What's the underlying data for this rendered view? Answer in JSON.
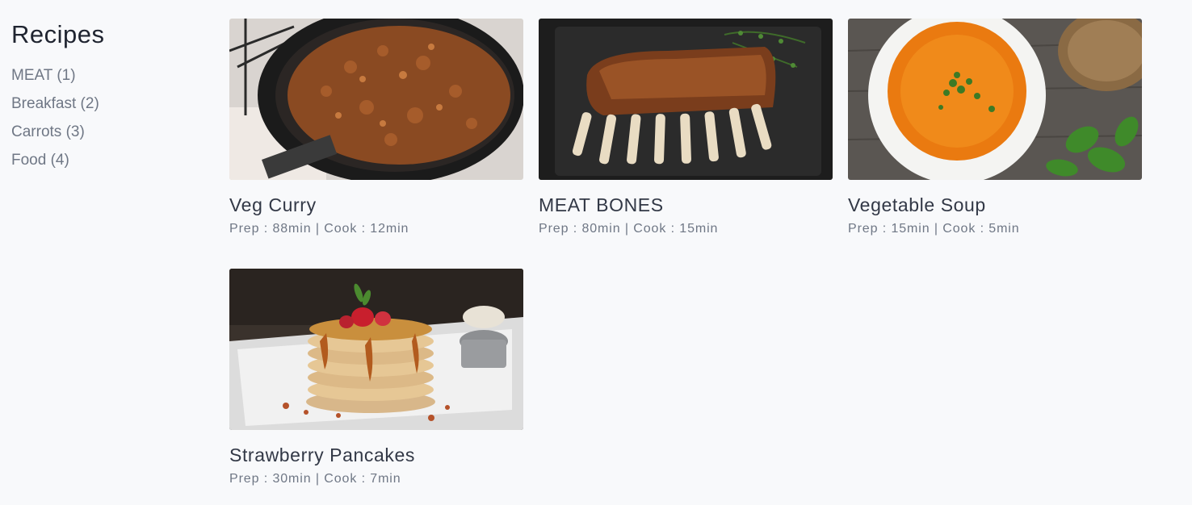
{
  "sidebar": {
    "title": "Recipes",
    "categories": [
      {
        "name": "MEAT",
        "count": "(1)"
      },
      {
        "name": "Breakfast",
        "count": "(2)"
      },
      {
        "name": "Carrots",
        "count": "(3)"
      },
      {
        "name": "Food",
        "count": "(4)"
      }
    ]
  },
  "recipes": [
    {
      "title": "Veg Curry",
      "prep_label": "Prep",
      "prep": "88min",
      "cook_label": "Cook",
      "cook": "12min"
    },
    {
      "title": "MEAT BONES",
      "prep_label": "Prep",
      "prep": "80min",
      "cook_label": "Cook",
      "cook": "15min"
    },
    {
      "title": "Vegetable Soup",
      "prep_label": "Prep",
      "prep": "15min",
      "cook_label": "Cook",
      "cook": "5min"
    },
    {
      "title": "Strawberry Pancakes",
      "prep_label": "Prep",
      "prep": "30min",
      "cook_label": "Cook",
      "cook": "7min"
    }
  ],
  "colors": {
    "background": "#f8f9fb",
    "heading": "#1f2430",
    "card_title": "#323846",
    "muted": "#6f7785"
  }
}
